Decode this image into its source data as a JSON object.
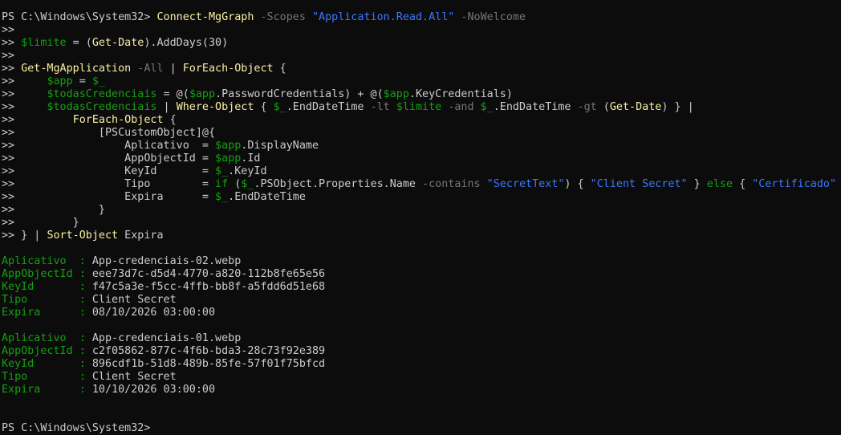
{
  "window": {
    "background": "#0c0c0c",
    "colors": {
      "default_text": "#cccccc",
      "command": "#f9f1a5",
      "variable": "#13a10e",
      "string": "#3b78ff",
      "parameter": "#767676"
    }
  },
  "console": {
    "lines": [
      [
        {
          "t": "PS C:\\Windows\\System32> ",
          "c": "w"
        },
        {
          "t": "Connect-MgGraph",
          "c": "y"
        },
        {
          "t": " -Scopes ",
          "c": "d"
        },
        {
          "t": "\"Application.Read.All\"",
          "c": "b"
        },
        {
          "t": " -NoWelcome",
          "c": "d"
        }
      ],
      [
        {
          "t": ">>",
          "c": "w"
        }
      ],
      [
        {
          "t": ">> ",
          "c": "w"
        },
        {
          "t": "$limite",
          "c": "g"
        },
        {
          "t": " = (",
          "c": "w"
        },
        {
          "t": "Get-Date",
          "c": "y"
        },
        {
          "t": ").AddDays(30)",
          "c": "w"
        }
      ],
      [
        {
          "t": ">>",
          "c": "w"
        }
      ],
      [
        {
          "t": ">> ",
          "c": "w"
        },
        {
          "t": "Get-MgApplication",
          "c": "y"
        },
        {
          "t": " -All",
          "c": "d"
        },
        {
          "t": " | ",
          "c": "w"
        },
        {
          "t": "ForEach-Object",
          "c": "y"
        },
        {
          "t": " {",
          "c": "w"
        }
      ],
      [
        {
          "t": ">>     ",
          "c": "w"
        },
        {
          "t": "$app",
          "c": "g"
        },
        {
          "t": " = ",
          "c": "w"
        },
        {
          "t": "$_",
          "c": "g"
        }
      ],
      [
        {
          "t": ">>     ",
          "c": "w"
        },
        {
          "t": "$todasCredenciais",
          "c": "g"
        },
        {
          "t": " = @(",
          "c": "w"
        },
        {
          "t": "$app",
          "c": "g"
        },
        {
          "t": ".PasswordCredentials) + @(",
          "c": "w"
        },
        {
          "t": "$app",
          "c": "g"
        },
        {
          "t": ".KeyCredentials)",
          "c": "w"
        }
      ],
      [
        {
          "t": ">>     ",
          "c": "w"
        },
        {
          "t": "$todasCredenciais",
          "c": "g"
        },
        {
          "t": " | ",
          "c": "w"
        },
        {
          "t": "Where-Object",
          "c": "y"
        },
        {
          "t": " { ",
          "c": "w"
        },
        {
          "t": "$_",
          "c": "g"
        },
        {
          "t": ".EndDateTime ",
          "c": "w"
        },
        {
          "t": "-lt",
          "c": "d"
        },
        {
          "t": " ",
          "c": "w"
        },
        {
          "t": "$limite",
          "c": "g"
        },
        {
          "t": " ",
          "c": "w"
        },
        {
          "t": "-and",
          "c": "d"
        },
        {
          "t": " ",
          "c": "w"
        },
        {
          "t": "$_",
          "c": "g"
        },
        {
          "t": ".EndDateTime ",
          "c": "w"
        },
        {
          "t": "-gt",
          "c": "d"
        },
        {
          "t": " (",
          "c": "w"
        },
        {
          "t": "Get-Date",
          "c": "y"
        },
        {
          "t": ") } |",
          "c": "w"
        }
      ],
      [
        {
          "t": ">>         ",
          "c": "w"
        },
        {
          "t": "ForEach-Object",
          "c": "y"
        },
        {
          "t": " {",
          "c": "w"
        }
      ],
      [
        {
          "t": ">>             [PSCustomObject]@{",
          "c": "w"
        }
      ],
      [
        {
          "t": ">>                 Aplicativo  = ",
          "c": "w"
        },
        {
          "t": "$app",
          "c": "g"
        },
        {
          "t": ".DisplayName",
          "c": "w"
        }
      ],
      [
        {
          "t": ">>                 AppObjectId = ",
          "c": "w"
        },
        {
          "t": "$app",
          "c": "g"
        },
        {
          "t": ".Id",
          "c": "w"
        }
      ],
      [
        {
          "t": ">>                 KeyId       = ",
          "c": "w"
        },
        {
          "t": "$_",
          "c": "g"
        },
        {
          "t": ".KeyId",
          "c": "w"
        }
      ],
      [
        {
          "t": ">>                 Tipo        = ",
          "c": "w"
        },
        {
          "t": "if",
          "c": "g"
        },
        {
          "t": " (",
          "c": "w"
        },
        {
          "t": "$_",
          "c": "g"
        },
        {
          "t": ".PSObject.Properties.Name ",
          "c": "w"
        },
        {
          "t": "-contains",
          "c": "d"
        },
        {
          "t": " ",
          "c": "w"
        },
        {
          "t": "\"SecretText\"",
          "c": "b"
        },
        {
          "t": ") { ",
          "c": "w"
        },
        {
          "t": "\"Client Secret\"",
          "c": "b"
        },
        {
          "t": " } ",
          "c": "w"
        },
        {
          "t": "else",
          "c": "g"
        },
        {
          "t": " { ",
          "c": "w"
        },
        {
          "t": "\"Certificado\"",
          "c": "b"
        },
        {
          "t": " }",
          "c": "w"
        }
      ],
      [
        {
          "t": ">>                 Expira      = ",
          "c": "w"
        },
        {
          "t": "$_",
          "c": "g"
        },
        {
          "t": ".EndDateTime",
          "c": "w"
        }
      ],
      [
        {
          "t": ">>             }",
          "c": "w"
        }
      ],
      [
        {
          "t": ">>         }",
          "c": "w"
        }
      ],
      [
        {
          "t": ">> } | ",
          "c": "w"
        },
        {
          "t": "Sort-Object",
          "c": "y"
        },
        {
          "t": " Expira",
          "c": "w"
        }
      ],
      [],
      [
        {
          "t": "Aplicativo  : ",
          "c": "g"
        },
        {
          "t": "App-credenciais-02.webp",
          "c": "w"
        }
      ],
      [
        {
          "t": "AppObjectId : ",
          "c": "g"
        },
        {
          "t": "eee73d7c-d5d4-4770-a820-112b8fe65e56",
          "c": "w"
        }
      ],
      [
        {
          "t": "KeyId       : ",
          "c": "g"
        },
        {
          "t": "f47c5a3e-f5cc-4ffb-bb8f-a5fdd6d51e68",
          "c": "w"
        }
      ],
      [
        {
          "t": "Tipo        : ",
          "c": "g"
        },
        {
          "t": "Client Secret",
          "c": "w"
        }
      ],
      [
        {
          "t": "Expira      : ",
          "c": "g"
        },
        {
          "t": "08/10/2026 03:00:00",
          "c": "w"
        }
      ],
      [],
      [
        {
          "t": "Aplicativo  : ",
          "c": "g"
        },
        {
          "t": "App-credenciais-01.webp",
          "c": "w"
        }
      ],
      [
        {
          "t": "AppObjectId : ",
          "c": "g"
        },
        {
          "t": "c2f05862-877c-4f6b-bda3-28c73f92e389",
          "c": "w"
        }
      ],
      [
        {
          "t": "KeyId       : ",
          "c": "g"
        },
        {
          "t": "896cdf1b-51d8-489b-85fe-57f01f75bfcd",
          "c": "w"
        }
      ],
      [
        {
          "t": "Tipo        : ",
          "c": "g"
        },
        {
          "t": "Client Secret",
          "c": "w"
        }
      ],
      [
        {
          "t": "Expira      : ",
          "c": "g"
        },
        {
          "t": "10/10/2026 03:00:00",
          "c": "w"
        }
      ],
      [],
      [],
      [
        {
          "t": "PS C:\\Windows\\System32>",
          "c": "w"
        }
      ]
    ]
  }
}
